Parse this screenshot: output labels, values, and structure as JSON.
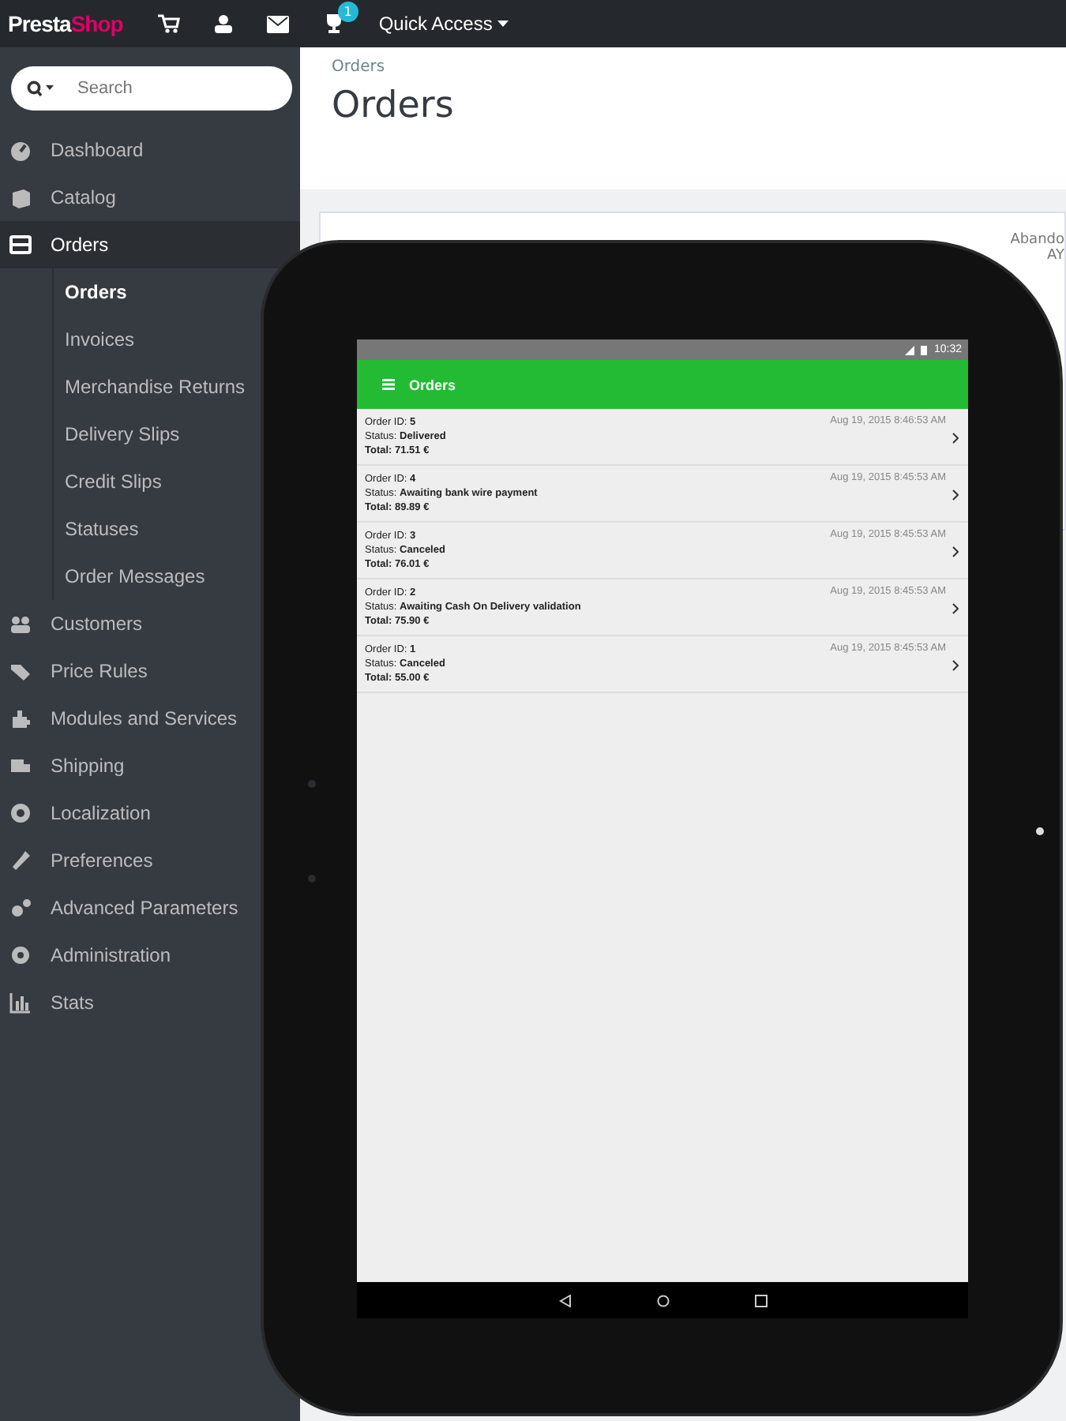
{
  "topbar": {
    "logo_left": "Presta",
    "logo_right": "Shop",
    "notification_count": "1",
    "quick_access": "Quick Access"
  },
  "search": {
    "placeholder": "Search"
  },
  "sidebar": {
    "items": [
      {
        "label": "Dashboard",
        "selected": false
      },
      {
        "label": "Catalog",
        "selected": false
      },
      {
        "label": "Orders",
        "selected": true,
        "children": [
          {
            "label": "Orders",
            "selected": true
          },
          {
            "label": "Invoices",
            "selected": false
          },
          {
            "label": "Merchandise Returns",
            "selected": false
          },
          {
            "label": "Delivery Slips",
            "selected": false
          },
          {
            "label": "Credit Slips",
            "selected": false
          },
          {
            "label": "Statuses",
            "selected": false
          },
          {
            "label": "Order Messages",
            "selected": false
          }
        ]
      },
      {
        "label": "Customers",
        "selected": false
      },
      {
        "label": "Price Rules",
        "selected": false
      },
      {
        "label": "Modules and Services",
        "selected": false
      },
      {
        "label": "Shipping",
        "selected": false
      },
      {
        "label": "Localization",
        "selected": false
      },
      {
        "label": "Preferences",
        "selected": false
      },
      {
        "label": "Advanced Parameters",
        "selected": false
      },
      {
        "label": "Administration",
        "selected": false
      },
      {
        "label": "Stats",
        "selected": false
      }
    ]
  },
  "page": {
    "breadcrumb": "Orders",
    "title": "Orders",
    "card_partial_text": [
      "Abando",
      "AY"
    ]
  },
  "tablet": {
    "clock": "10:32",
    "app_title": "Orders",
    "orders": [
      {
        "id_label": "Order ID: ",
        "id": "5",
        "status_label": "Status: ",
        "status": "Delivered",
        "total": "Total: 71.51 €",
        "date": "Aug 19, 2015 8:46:53 AM"
      },
      {
        "id_label": "Order ID: ",
        "id": "4",
        "status_label": "Status: ",
        "status": "Awaiting bank wire payment",
        "total": "Total: 89.89 €",
        "date": "Aug 19, 2015 8:45:53 AM"
      },
      {
        "id_label": "Order ID: ",
        "id": "3",
        "status_label": "Status: ",
        "status": "Canceled",
        "total": "Total: 76.01 €",
        "date": "Aug 19, 2015 8:45:53 AM"
      },
      {
        "id_label": "Order ID: ",
        "id": "2",
        "status_label": "Status: ",
        "status": "Awaiting Cash On Delivery validation",
        "total": "Total: 75.90 €",
        "date": "Aug 19, 2015 8:45:53 AM"
      },
      {
        "id_label": "Order ID: ",
        "id": "1",
        "status_label": "Status: ",
        "status": "Canceled",
        "total": "Total: 55.00 €",
        "date": "Aug 19, 2015 8:45:53 AM"
      }
    ]
  }
}
